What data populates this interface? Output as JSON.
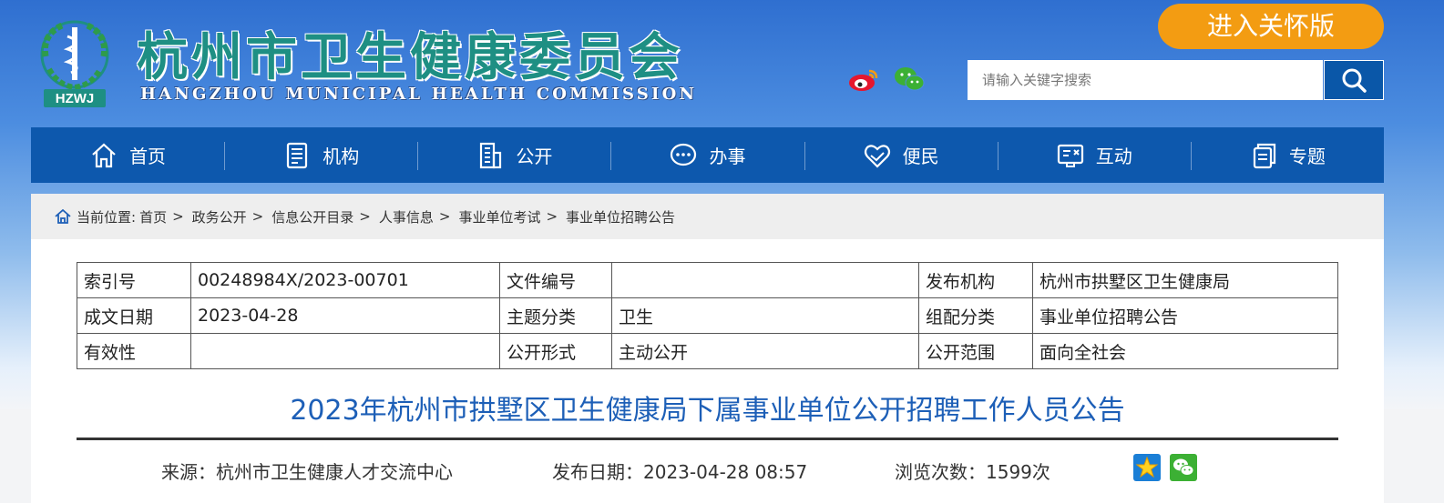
{
  "header": {
    "logo_text": "HZWJ",
    "title_cn": "杭州市卫生健康委员会",
    "title_en": "HANGZHOU MUNICIPAL HEALTH COMMISSION",
    "care_button": "进入关怀版",
    "search_placeholder": "请输入关键字搜索",
    "icons": [
      "weibo-icon",
      "wechat-icon",
      "search-icon"
    ]
  },
  "nav": {
    "items": [
      {
        "label": "首页",
        "icon": "home-icon"
      },
      {
        "label": "机构",
        "icon": "document-icon"
      },
      {
        "label": "公开",
        "icon": "building-icon"
      },
      {
        "label": "办事",
        "icon": "chat-icon"
      },
      {
        "label": "便民",
        "icon": "heart-hands-icon"
      },
      {
        "label": "互动",
        "icon": "board-icon"
      },
      {
        "label": "专题",
        "icon": "layers-icon"
      }
    ]
  },
  "breadcrumb": {
    "prefix": "当前位置:",
    "items": [
      "首页",
      "政务公开",
      "信息公开目录",
      "人事信息",
      "事业单位考试",
      "事业单位招聘公告"
    ],
    "separator": ">"
  },
  "meta": {
    "rows": [
      [
        "索引号",
        "00248984X/2023-00701",
        "文件编号",
        "",
        "发布机构",
        "杭州市拱墅区卫生健康局"
      ],
      [
        "成文日期",
        "2023-04-28",
        "主题分类",
        "卫生",
        "组配分类",
        "事业单位招聘公告"
      ],
      [
        "有效性",
        "",
        "公开形式",
        "主动公开",
        "公开范围",
        "面向全社会"
      ]
    ]
  },
  "article": {
    "title": "2023年杭州市拱墅区卫生健康局下属事业单位公开招聘工作人员公告",
    "source": "来源：杭州市卫生健康人才交流中心",
    "publish_date": "发布日期：2023-04-28 08:57",
    "views": "浏览次数：1599次"
  },
  "colors": {
    "nav_bg": "#0d58ad",
    "care_button": "#f39c12",
    "title": "#1d5fb7",
    "brand_green": "#1e8f83"
  }
}
